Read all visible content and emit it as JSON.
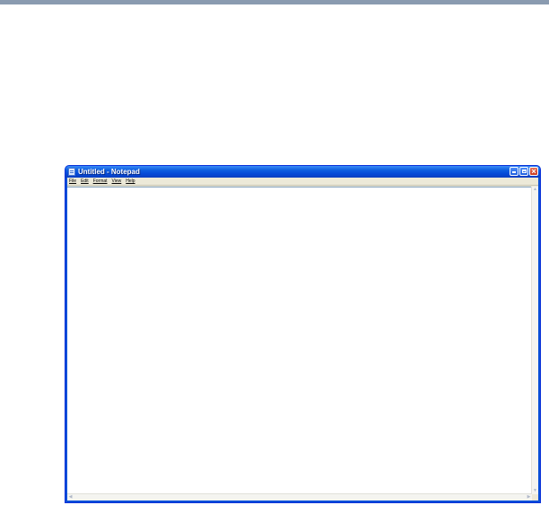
{
  "window": {
    "title": "Untitled - Notepad",
    "icon": "notepad-icon",
    "caption_buttons": [
      "minimize-icon",
      "maximize-icon",
      "close-icon"
    ]
  },
  "menubar": {
    "items": [
      {
        "label": "File"
      },
      {
        "label": "Edit"
      },
      {
        "label": "Format"
      },
      {
        "label": "View"
      },
      {
        "label": "Help"
      }
    ]
  },
  "document": {
    "content": ""
  },
  "colors": {
    "titlebar": "#0548d6",
    "close_button": "#c8391f",
    "top_rule": "#8a9bb0"
  }
}
